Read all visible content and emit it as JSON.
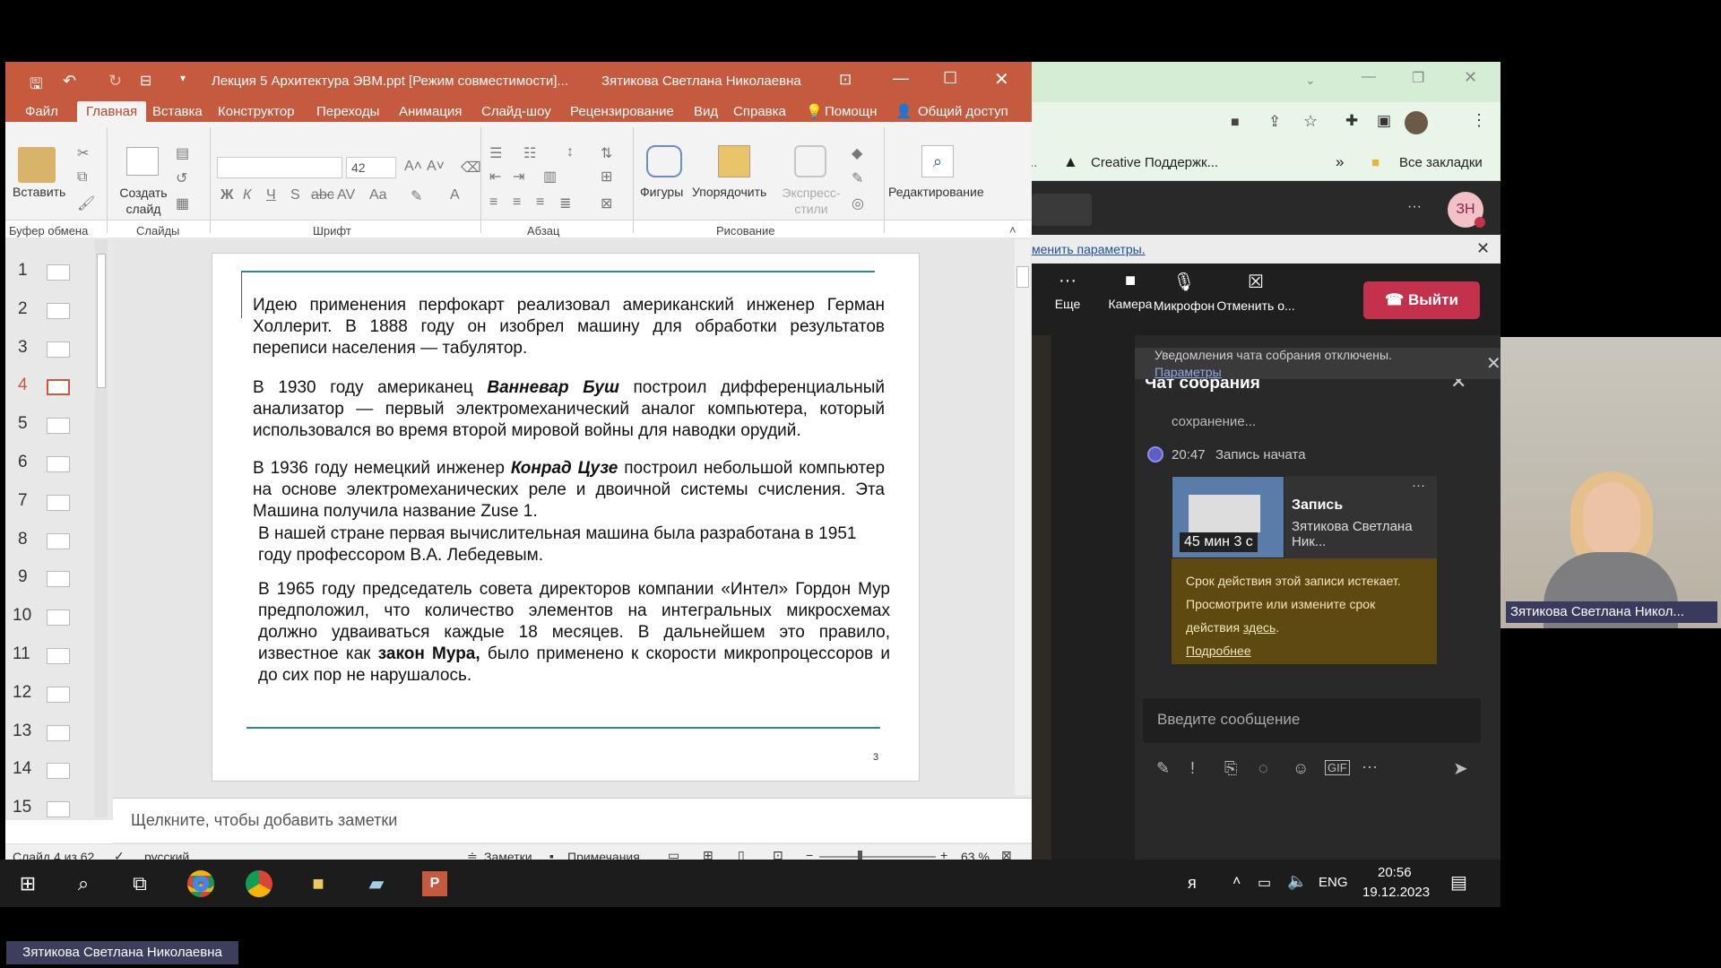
{
  "ppt": {
    "title": "Лекция 5 Архитектура ЭВМ.ppt [Режим совместимости]...",
    "user": "Зятикова Светлана Николаевна",
    "menu": [
      "Файл",
      "Главная",
      "Вставка",
      "Конструктор",
      "Переходы",
      "Анимация",
      "Слайд-шоу",
      "Рецензирование",
      "Вид",
      "Справка",
      "Помощн",
      "Общий доступ"
    ],
    "ribbon": {
      "paste": "Вставить",
      "new_slide": "Создать слайд",
      "font_size": "42",
      "shapes": "Фигуры",
      "arrange": "Упорядочить",
      "quick_styles": "Экспресс-стили",
      "editing": "Редактирование",
      "groups": [
        "Буфер обмена",
        "Слайды",
        "Шрифт",
        "Абзац",
        "Рисование"
      ]
    },
    "thumbs": [
      "1",
      "2",
      "3",
      "4",
      "5",
      "6",
      "7",
      "8",
      "9",
      "10",
      "11",
      "12",
      "13",
      "14",
      "15"
    ],
    "slide": {
      "p1": "Идею применения перфокарт реализовал американский инженер Герман Холлерит. В 1888 году он изобрел машину для обработки результатов переписи населения — табулятор.",
      "p2a": "В 1930 году американец ",
      "p2b": "Ванневар Буш",
      "p2c": " построил дифференциальный анализатор — первый электромеханический аналог компьютера, который использовался во время второй мировой войны для наводки орудий.",
      "p3a": "В 1936 году немецкий инженер ",
      "p3b": "Конрад Цузе",
      "p3c": " построил небольшой компьютер на основе электромеханических реле и двоичной системы счисления. Эта Машина получила название Zuse 1.",
      "p4": "В нашей стране первая вычислительная машина была разработана в 1951 году профессором В.А. Лебедевым.",
      "p5a": "В 1965 году председатель совета директоров компании «Интел» Гордон Мур предположил, что количество элементов на интегральных микросхемах должно удваиваться каждые 18 месяцев. В дальнейшем это правило, известное как ",
      "p5b": "закон Мура,",
      "p5c": " было применено к скорости микропроцессоров и до сих пор не нарушалось.",
      "page": "3"
    },
    "notes_placeholder": "Щелкните, чтобы добавить заметки",
    "status": {
      "slide_of": "Слайд 4 из 62",
      "lang": "русский",
      "notes": "Заметки",
      "comments": "Примечания",
      "zoom": "63 %"
    }
  },
  "chrome": {
    "bookmark": "Creative Поддержк...",
    "all_bookmarks": "Все закладки",
    "avatar": "ЗН",
    "banner": "менить параметры.",
    "call": {
      "more": "Еще",
      "camera": "Камера",
      "mic": "Микрофон",
      "share": "Отменить о...",
      "leave": "Выйти"
    },
    "notice": "Уведомления чата собрания отключены.",
    "notice_link": "Параметры",
    "chat_title": "Чат собрания",
    "saving": "сохранение...",
    "record_time": "20:47",
    "record_started": "Запись начата",
    "rec_title": "Запись",
    "rec_author": "Зятикова Светлана Ник...",
    "rec_duration": "45 мин 3 с",
    "warn_text": "Срок действия этой записи истекает. Просмотрите или измените срок действия ",
    "warn_link": "здесь",
    "warn_more": "Подробнее",
    "input_placeholder": "Введите сообщение"
  },
  "video_name": "Зятикова Светлана Никол...",
  "taskbar": {
    "lang": "ENG",
    "time": "20:56",
    "date": "19.12.2023"
  },
  "presenter": "Зятикова Светлана Николаевна"
}
